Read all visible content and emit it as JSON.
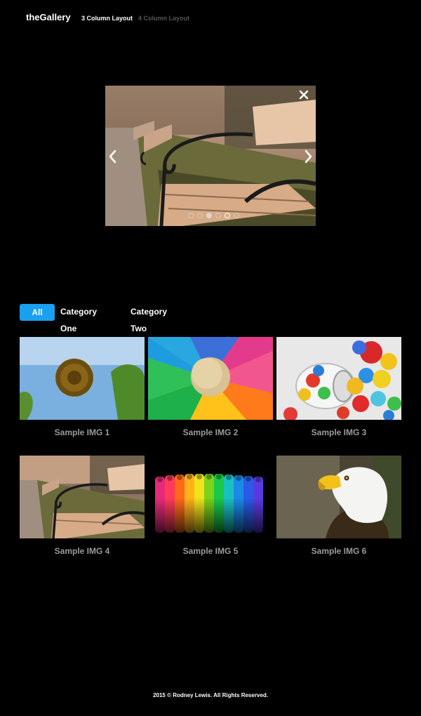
{
  "header": {
    "brand": "theGallery",
    "nav": [
      {
        "label": "3 Column Layout",
        "active": true
      },
      {
        "label": "4 Column Layout",
        "active": false
      }
    ]
  },
  "lightbox": {
    "image": "park-bench",
    "dots": 6,
    "active_dot_index": 2
  },
  "filters": {
    "tabs": [
      {
        "label": "All",
        "active": true
      },
      {
        "label": "Category One",
        "active": false
      },
      {
        "label": "Category Two",
        "active": false
      }
    ],
    "accent_color": "#1aa0f0"
  },
  "gallery": {
    "items": [
      {
        "caption": "Sample IMG 1",
        "image": "sunflower"
      },
      {
        "caption": "Sample IMG 2",
        "image": "pinwheel"
      },
      {
        "caption": "Sample IMG 3",
        "image": "marbles"
      },
      {
        "caption": "Sample IMG 4",
        "image": "park-bench"
      },
      {
        "caption": "Sample IMG 5",
        "image": "colored-straws"
      },
      {
        "caption": "Sample IMG 6",
        "image": "bald-eagle"
      }
    ]
  },
  "footer": {
    "text": "2015 © Rodney Lewis. All Rights Reserved."
  }
}
